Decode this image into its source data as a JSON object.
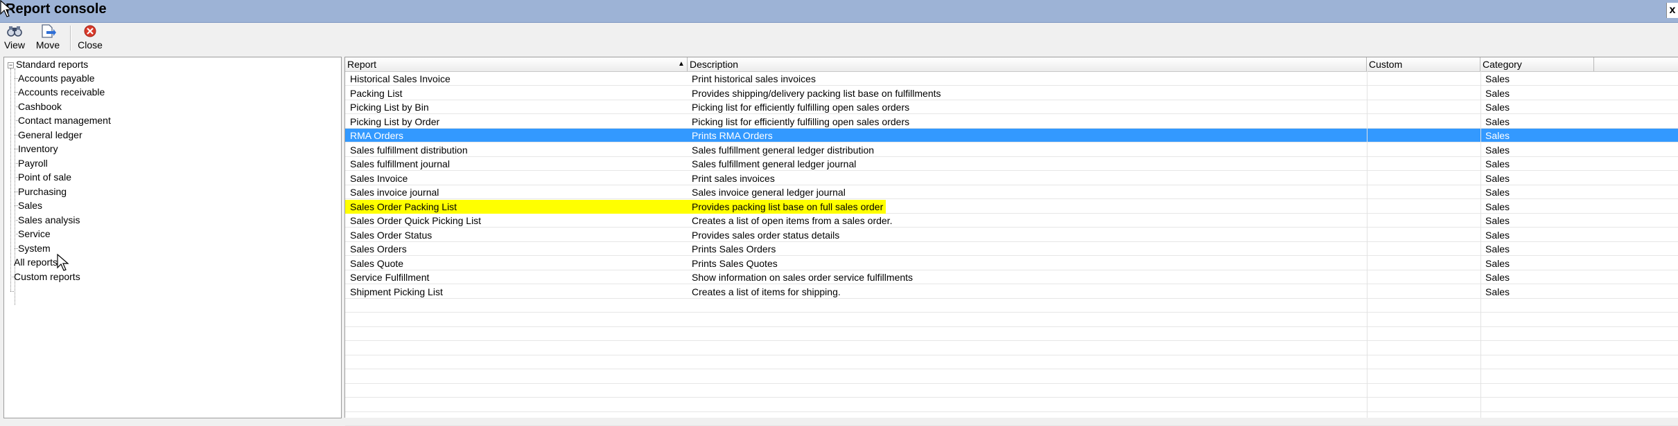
{
  "window": {
    "title": "Report console",
    "close_glyph": "x"
  },
  "toolbar": {
    "buttons": [
      {
        "label": "View",
        "icon": "binoculars-icon"
      },
      {
        "label": "Move",
        "icon": "move-document-icon"
      },
      {
        "label": "Close",
        "icon": "red-close-icon"
      }
    ]
  },
  "tree": {
    "root": {
      "label": "Standard reports",
      "expander": "−"
    },
    "children": [
      {
        "label": "Accounts payable"
      },
      {
        "label": "Accounts receivable"
      },
      {
        "label": "Cashbook"
      },
      {
        "label": "Contact management"
      },
      {
        "label": "General ledger"
      },
      {
        "label": "Inventory"
      },
      {
        "label": "Payroll"
      },
      {
        "label": "Point of sale"
      },
      {
        "label": "Purchasing"
      },
      {
        "label": "Sales"
      },
      {
        "label": "Sales analysis"
      },
      {
        "label": "Service"
      },
      {
        "label": "System"
      }
    ],
    "others": [
      {
        "label": "All reports"
      },
      {
        "label": "Custom reports"
      }
    ]
  },
  "grid": {
    "columns": [
      {
        "label": "Report",
        "sort": "▲"
      },
      {
        "label": "Description"
      },
      {
        "label": "Custom"
      },
      {
        "label": "Category"
      }
    ],
    "rows": [
      {
        "report": "Historical Sales Invoice",
        "description": "Print historical sales invoices",
        "custom": "",
        "category": "Sales"
      },
      {
        "report": "Packing List",
        "description": "Provides shipping/delivery packing list base on fulfillments",
        "custom": "",
        "category": "Sales"
      },
      {
        "report": "Picking List by Bin",
        "description": "Picking list for efficiently fulfilling open sales orders",
        "custom": "",
        "category": "Sales"
      },
      {
        "report": "Picking List by Order",
        "description": "Picking list for efficiently fulfilling open sales orders",
        "custom": "",
        "category": "Sales"
      },
      {
        "report": "RMA Orders",
        "description": "Prints RMA Orders",
        "custom": "",
        "category": "Sales",
        "selected": true
      },
      {
        "report": "Sales fulfillment distribution",
        "description": "Sales fulfillment general ledger distribution",
        "custom": "",
        "category": "Sales"
      },
      {
        "report": "Sales fulfillment journal",
        "description": "Sales fulfillment general ledger journal",
        "custom": "",
        "category": "Sales"
      },
      {
        "report": "Sales Invoice",
        "description": "Print sales invoices",
        "custom": "",
        "category": "Sales"
      },
      {
        "report": "Sales invoice journal",
        "description": "Sales invoice general ledger journal",
        "custom": "",
        "category": "Sales"
      },
      {
        "report": "Sales Order Packing List",
        "description": "Provides packing list base on full sales order",
        "custom": "",
        "category": "Sales",
        "highlighted": true
      },
      {
        "report": "Sales Order Quick Picking List",
        "description": "Creates a list of open items from a sales order.",
        "custom": "",
        "category": "Sales"
      },
      {
        "report": "Sales Order Status",
        "description": "Provides sales order status details",
        "custom": "",
        "category": "Sales"
      },
      {
        "report": "Sales Orders",
        "description": "Prints Sales Orders",
        "custom": "",
        "category": "Sales"
      },
      {
        "report": "Sales Quote",
        "description": "Prints Sales Quotes",
        "custom": "",
        "category": "Sales"
      },
      {
        "report": "Service Fulfillment",
        "description": "Show information on sales order service fulfillments",
        "custom": "",
        "category": "Sales"
      },
      {
        "report": "Shipment Picking List",
        "description": "Creates a list of items for shipping.",
        "custom": "",
        "category": "Sales"
      }
    ]
  },
  "colors": {
    "titlebar": "#9db3d6",
    "selection": "#3399ff",
    "highlight": "#ffff00"
  }
}
